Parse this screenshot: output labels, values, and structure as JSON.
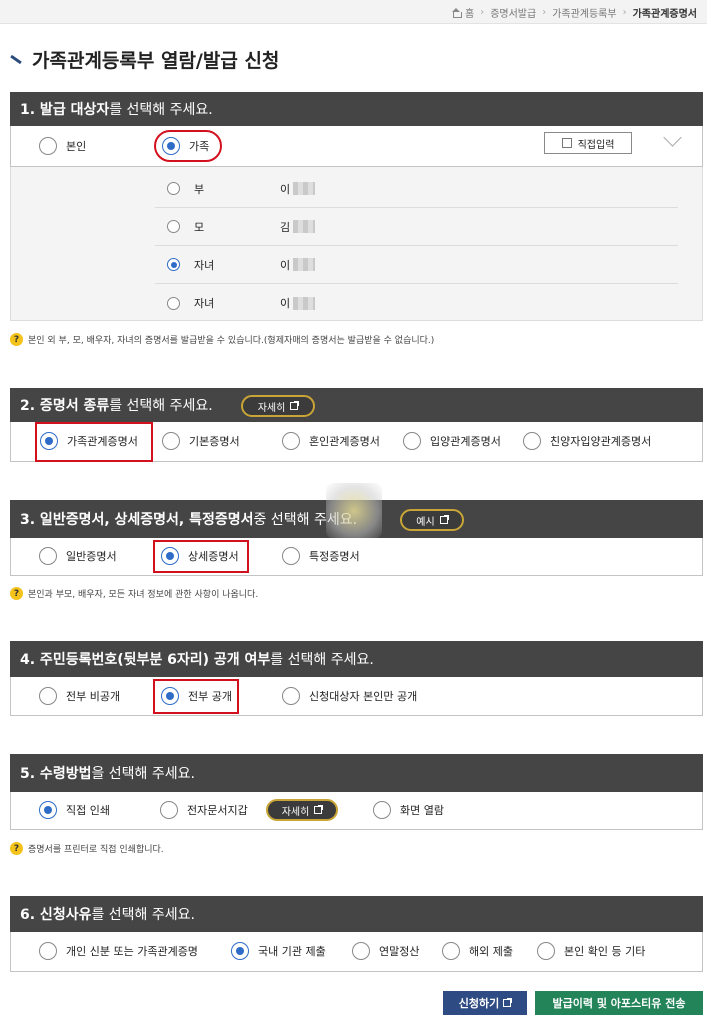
{
  "breadcrumb": [
    "홈",
    "증명서발급",
    "가족관계등록부",
    "가족관계증명서"
  ],
  "page_title": "가족관계등록부 열람/발급 신청",
  "s1": {
    "title_bold": "1. 발급 대상자",
    "title_rest": "를 선택해 주세요.",
    "options": [
      "본인",
      "가족"
    ],
    "selected": "가족",
    "direct_input": "직접입력",
    "family": [
      {
        "relation": "부",
        "name": "이"
      },
      {
        "relation": "모",
        "name": "김"
      },
      {
        "relation": "자녀",
        "name": "이"
      },
      {
        "relation": "자녀",
        "name": "이"
      }
    ],
    "family_selected": 2,
    "note": "본인 외 부, 모, 배우자, 자녀의 증명서를 발급받을 수 있습니다.(형제자매의 증명서는 발급받을 수 없습니다.)"
  },
  "s2": {
    "title_bold": "2. 증명서 종류",
    "title_rest": "를 선택해 주세요.",
    "detail_btn": "자세히",
    "options": [
      "가족관계증명서",
      "기본증명서",
      "혼인관계증명서",
      "입양관계증명서",
      "친양자입양관계증명서"
    ],
    "selected": "가족관계증명서"
  },
  "s3": {
    "title_bold": "3. 일반증명서, 상세증명서, 특정증명서",
    "title_rest": " 중 선택해 주세요.",
    "example_btn": "예시",
    "options": [
      "일반증명서",
      "상세증명서",
      "특정증명서"
    ],
    "selected": "상세증명서",
    "note": "본인과 부모, 배우자, 모든 자녀 정보에 관한 사항이 나옵니다."
  },
  "s4": {
    "title_bold": "4. 주민등록번호(뒷부분 6자리) 공개 여부",
    "title_rest": "를 선택해 주세요.",
    "options": [
      "전부 비공개",
      "전부 공개",
      "신청대상자 본인만 공개"
    ],
    "selected": "전부 공개"
  },
  "s5": {
    "title_bold": "5. 수령방법",
    "title_rest": "을 선택해 주세요.",
    "options": [
      "직접 인쇄",
      "전자문서지갑",
      "화면 열람"
    ],
    "detail_btn": "자세히",
    "selected": "직접 인쇄",
    "note": "증명서를 프린터로 직접 인쇄합니다."
  },
  "s6": {
    "title_bold": "6. 신청사유",
    "title_rest": "를 선택해 주세요.",
    "options": [
      "개인 신분 또는 가족관계증명",
      "국내 기관 제출",
      "연말정산",
      "해외 제출",
      "본인 확인 등 기타"
    ],
    "selected": "국내 기관 제출"
  },
  "buttons": {
    "apply": "신청하기",
    "history": "발급이력 및 아포스티유 전송"
  },
  "colors": {
    "header_bg": "#454545",
    "radio_accent": "#2e6cc8",
    "highlight": "#d3101e",
    "apply_btn": "#2f4b84",
    "history_btn": "#23845a",
    "help_icon": "#f3c21b"
  }
}
